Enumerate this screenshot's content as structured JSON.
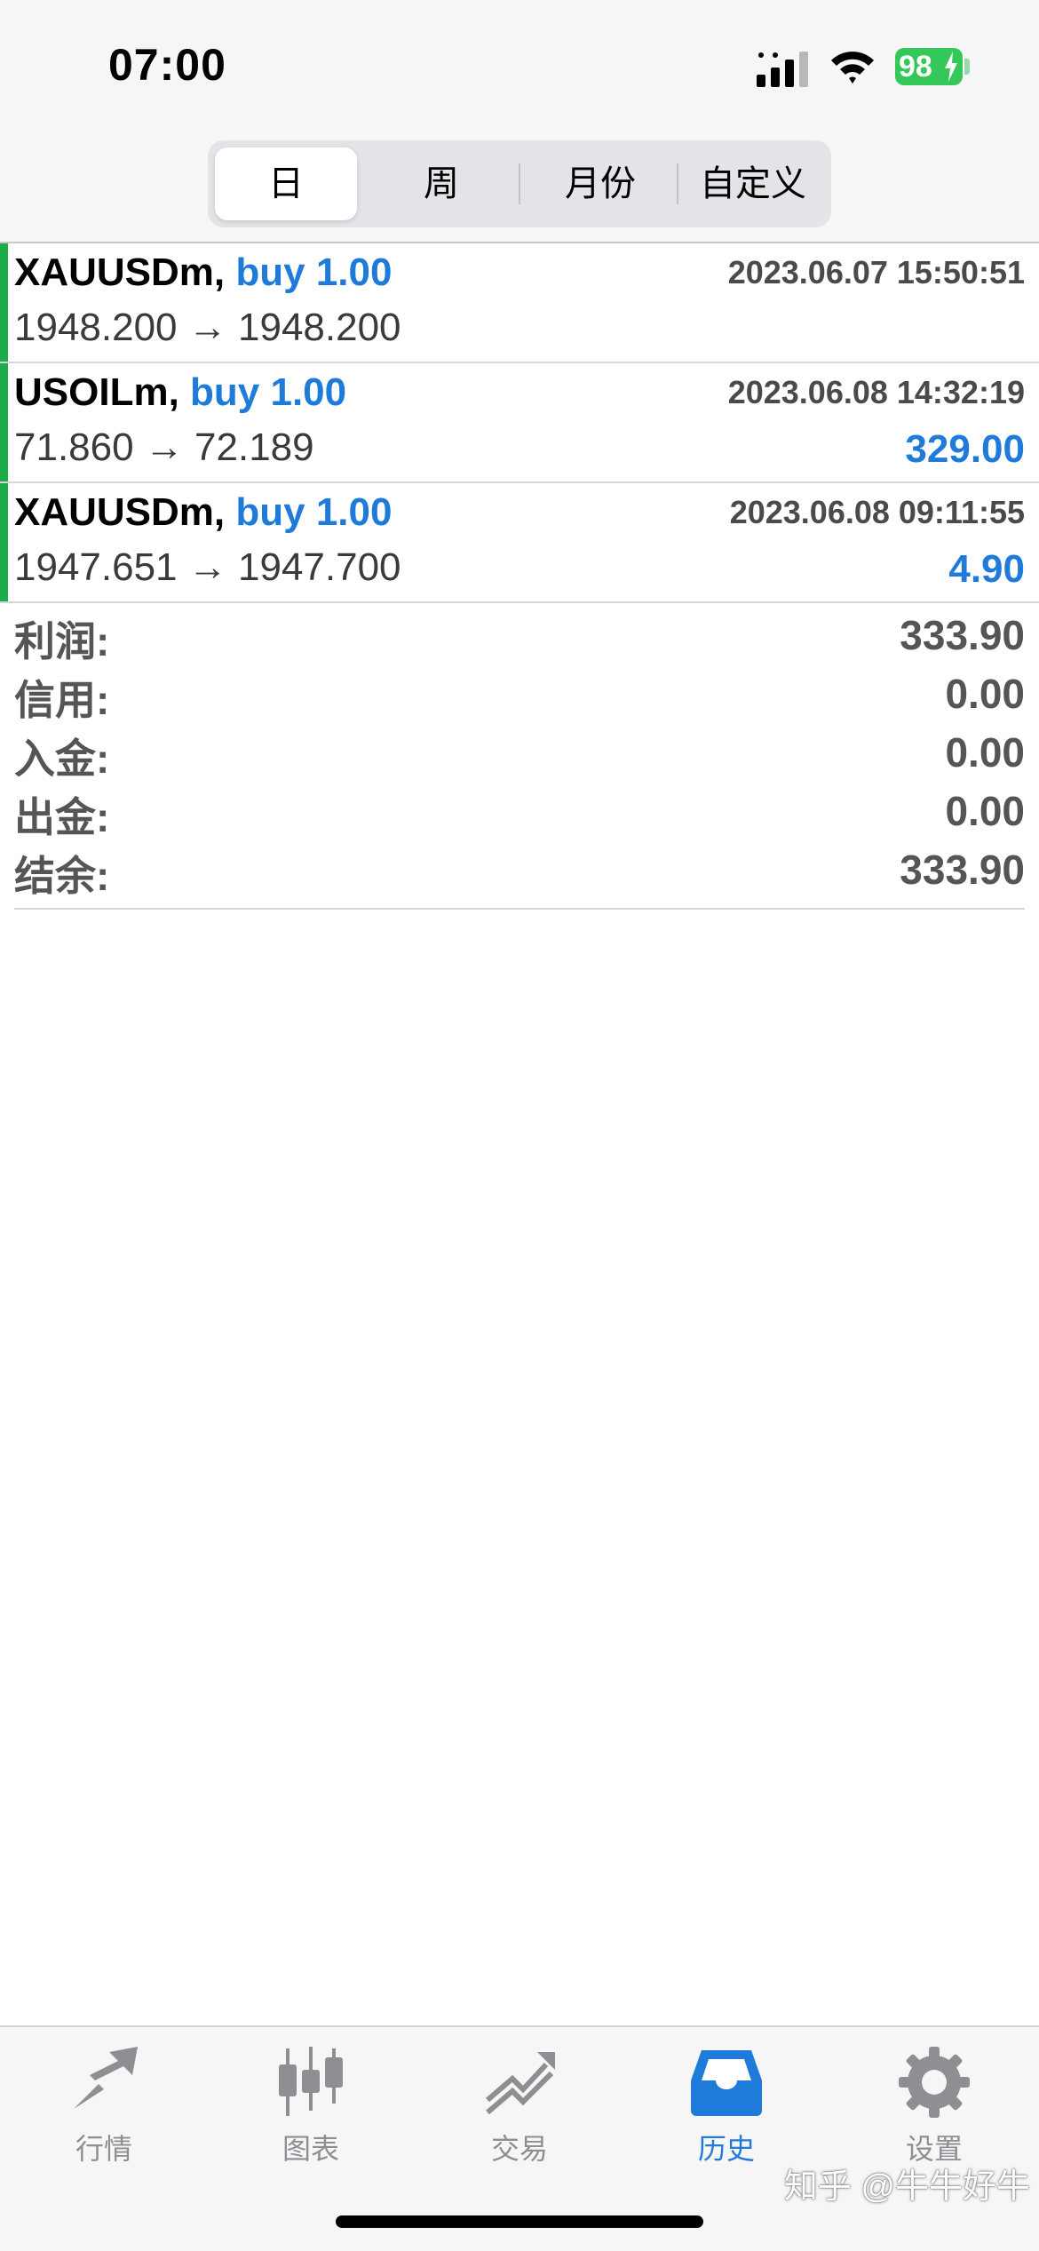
{
  "status_bar": {
    "time": "07:00",
    "battery": "98"
  },
  "segments": [
    {
      "label": "日",
      "active": true
    },
    {
      "label": "周",
      "active": false
    },
    {
      "label": "月份",
      "active": false
    },
    {
      "label": "自定义",
      "active": false
    }
  ],
  "deals": [
    {
      "symbol": "XAUUSDm,",
      "type": "buy 1.00",
      "time": "2023.06.07 15:50:51",
      "open_price": "1948.200",
      "arrow": "→",
      "close_price": "1948.200",
      "profit": ""
    },
    {
      "symbol": "USOILm,",
      "type": "buy 1.00",
      "time": "2023.06.08 14:32:19",
      "open_price": "71.860",
      "arrow": "→",
      "close_price": "72.189",
      "profit": "329.00"
    },
    {
      "symbol": "XAUUSDm,",
      "type": "buy 1.00",
      "time": "2023.06.08 09:11:55",
      "open_price": "1947.651",
      "arrow": "→",
      "close_price": "1947.700",
      "profit": "4.90"
    }
  ],
  "summary": [
    {
      "label": "利润:",
      "value": "333.90"
    },
    {
      "label": "信用:",
      "value": "0.00"
    },
    {
      "label": "入金:",
      "value": "0.00"
    },
    {
      "label": "出金:",
      "value": "0.00"
    },
    {
      "label": "结余:",
      "value": "333.90"
    }
  ],
  "tabs": [
    {
      "label": "行情",
      "icon": "quotes-icon",
      "active": false
    },
    {
      "label": "图表",
      "icon": "candlestick-chart-icon",
      "active": false
    },
    {
      "label": "交易",
      "icon": "trade-icon",
      "active": false
    },
    {
      "label": "历史",
      "icon": "history-inbox-icon",
      "active": true
    },
    {
      "label": "设置",
      "icon": "gear-icon",
      "active": false
    }
  ],
  "watermark": "知乎 @牛牛好牛",
  "colors": {
    "accent": "#1f7bd9",
    "buy_bar": "#1aad4a",
    "battery": "#34c759",
    "inactive_tab": "#8e8e93"
  }
}
